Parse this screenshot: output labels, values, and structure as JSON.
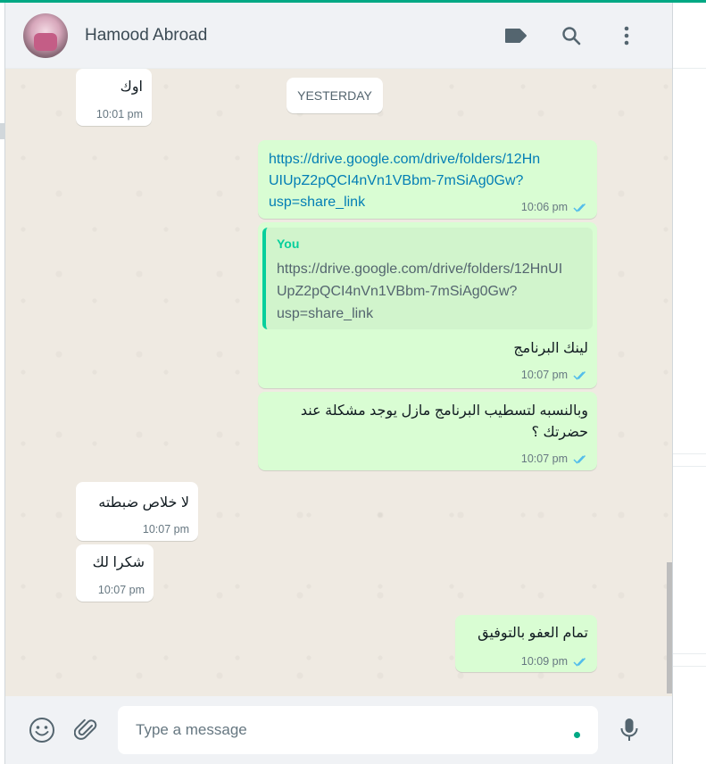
{
  "header": {
    "contact_name": "Hamood Abroad",
    "icons": [
      "label-icon",
      "search-icon",
      "menu-icon"
    ]
  },
  "date_separator": "YESTERDAY",
  "messages": [
    {
      "direction": "in",
      "text": "اوك",
      "time": "10:01 pm"
    },
    {
      "direction": "out",
      "text": "https://drive.google.com/drive/folders/12HnUIUpZ2pQCI4nVn1VBbm-7mSiAg0Gw?usp=share_link",
      "lines": [
        "https://drive.google.com/drive/folders/12Hn",
        "UIUpZ2pQCI4nVn1VBbm-7mSiAg0Gw?",
        "usp=share_link"
      ],
      "time": "10:06 pm",
      "status": "read"
    },
    {
      "direction": "out",
      "quote": {
        "author": "You",
        "lines": [
          "https://drive.google.com/drive/folders/12HnUI",
          "UpZ2pQCI4nVn1VBbm-7mSiAg0Gw?",
          "usp=share_link"
        ]
      },
      "text": "لينك البرنامج",
      "time": "10:07 pm",
      "status": "read"
    },
    {
      "direction": "out",
      "lines": [
        "وبالنسبه لتسطيب البرنامج مازل يوجد مشكلة عند",
        "حضرتك ؟"
      ],
      "time": "10:07 pm",
      "status": "read"
    },
    {
      "direction": "in",
      "text": "لا خلاص ضبطته",
      "time": "10:07 pm"
    },
    {
      "direction": "in",
      "text": "شكرا لك",
      "time": "10:07 pm"
    },
    {
      "direction": "out",
      "text": "تمام العفو بالتوفيق",
      "time": "10:09 pm",
      "status": "read"
    }
  ],
  "composer": {
    "placeholder": "Type a message",
    "icons": [
      "emoji-icon",
      "attach-icon",
      "mic-icon"
    ]
  },
  "colors": {
    "accent": "#00a884",
    "outgoing_bubble": "#d9fdd3",
    "incoming_bubble": "#ffffff",
    "chat_background": "#efeae2",
    "read_ticks": "#53bdeb"
  }
}
